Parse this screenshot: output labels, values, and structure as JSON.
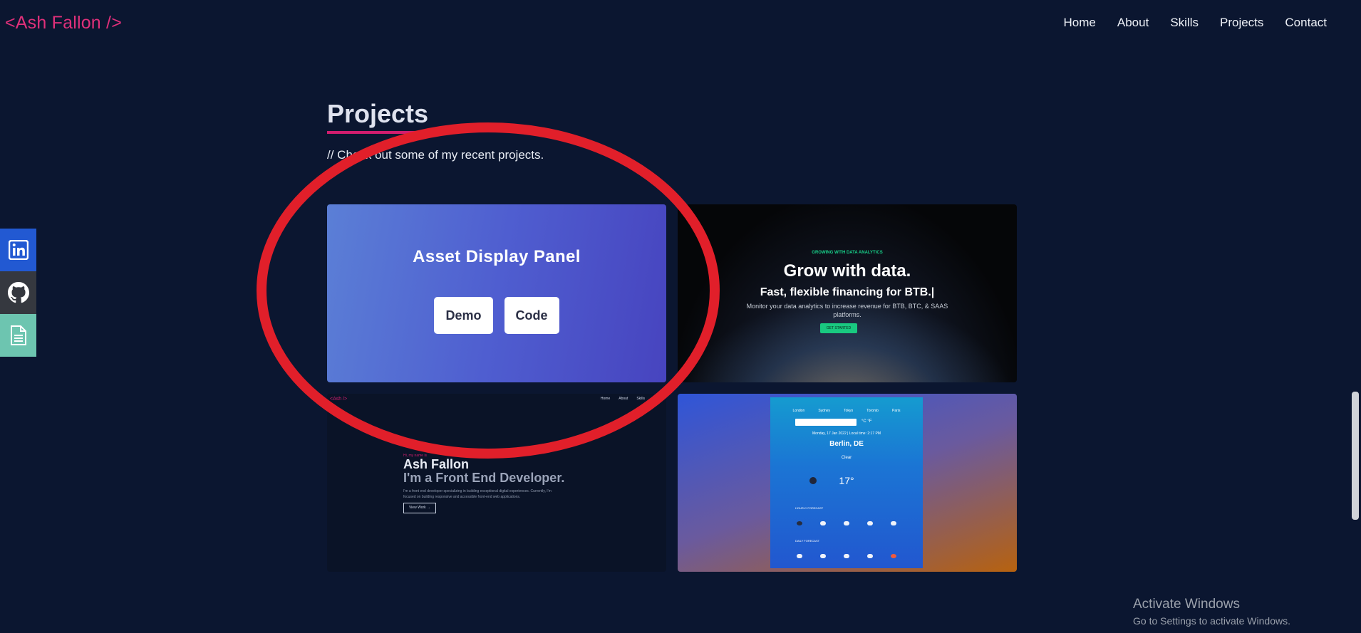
{
  "logo": "<Ash Fallon />",
  "nav": [
    "Home",
    "About",
    "Skills",
    "Projects",
    "Contact"
  ],
  "social": [
    "linkedin-icon",
    "github-icon",
    "resume-icon"
  ],
  "section": {
    "title": "Projects",
    "subtitle": "// Check out some of my recent projects."
  },
  "card1": {
    "title": "Asset Display Panel",
    "demo": "Demo",
    "code": "Code"
  },
  "card2": {
    "small": "GROWING WITH DATA ANALYTICS",
    "headline": "Grow with data.",
    "sub": "Fast, flexible financing for BTB.|",
    "text": "Monitor your data analytics to increase revenue for BTB, BTC, & SAAS platforms.",
    "btn": "GET STARTED"
  },
  "card3": {
    "logo": "<Ash />",
    "nav": [
      "Home",
      "About",
      "Skills"
    ],
    "hi": "Hi, my name is",
    "name": "Ash Fallon",
    "role": "I'm a Front End Developer.",
    "text": "I'm a front end developer specializing in building exceptional digital experiences. Currently, I'm focused on building responsive and accessible front-end web applications.",
    "btn": "View Work →"
  },
  "card4": {
    "tabs": [
      "London",
      "Sydney",
      "Tokyo",
      "Toronto",
      "Paris"
    ],
    "units": "°C  °F",
    "date": "Monday, 17 Jan 2022 | Local time: 2:17 PM",
    "city": "Berlin, DE",
    "condition": "Clear",
    "temp": "17°",
    "hourly_label": "HOURLY FORECAST",
    "daily_label": "DAILY FORECAST"
  },
  "activate": {
    "line1": "Activate Windows",
    "line2": "Go to Settings to activate Windows."
  },
  "colors": {
    "bg": "#0b1630",
    "accent": "#e0307a",
    "annotation": "#e11f2a"
  }
}
